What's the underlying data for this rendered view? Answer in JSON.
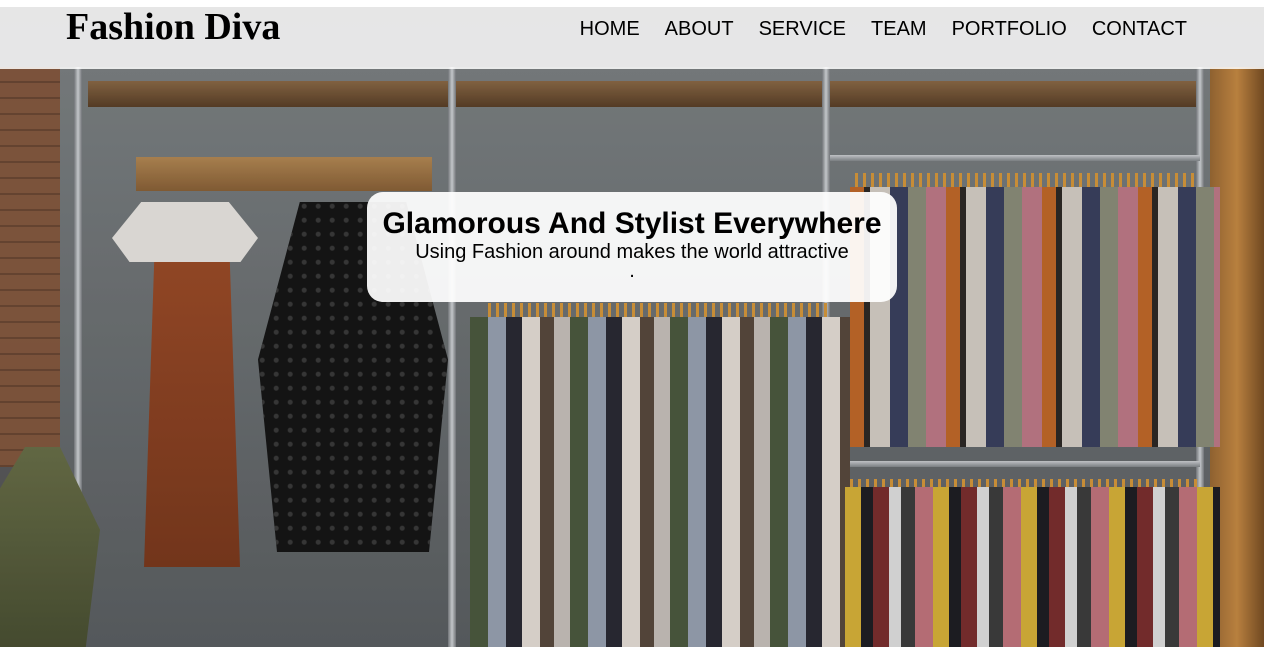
{
  "site": {
    "logo": "Fashion Diva"
  },
  "nav": {
    "items": [
      {
        "label": "HOME"
      },
      {
        "label": "ABOUT"
      },
      {
        "label": "SERVICE"
      },
      {
        "label": "TEAM"
      },
      {
        "label": "PORTFOLIO"
      },
      {
        "label": "CONTACT"
      }
    ]
  },
  "hero": {
    "title": "Glamorous And Stylist Everywhere",
    "subtitle": "Using Fashion around makes the world attractive",
    "trailing": "."
  }
}
